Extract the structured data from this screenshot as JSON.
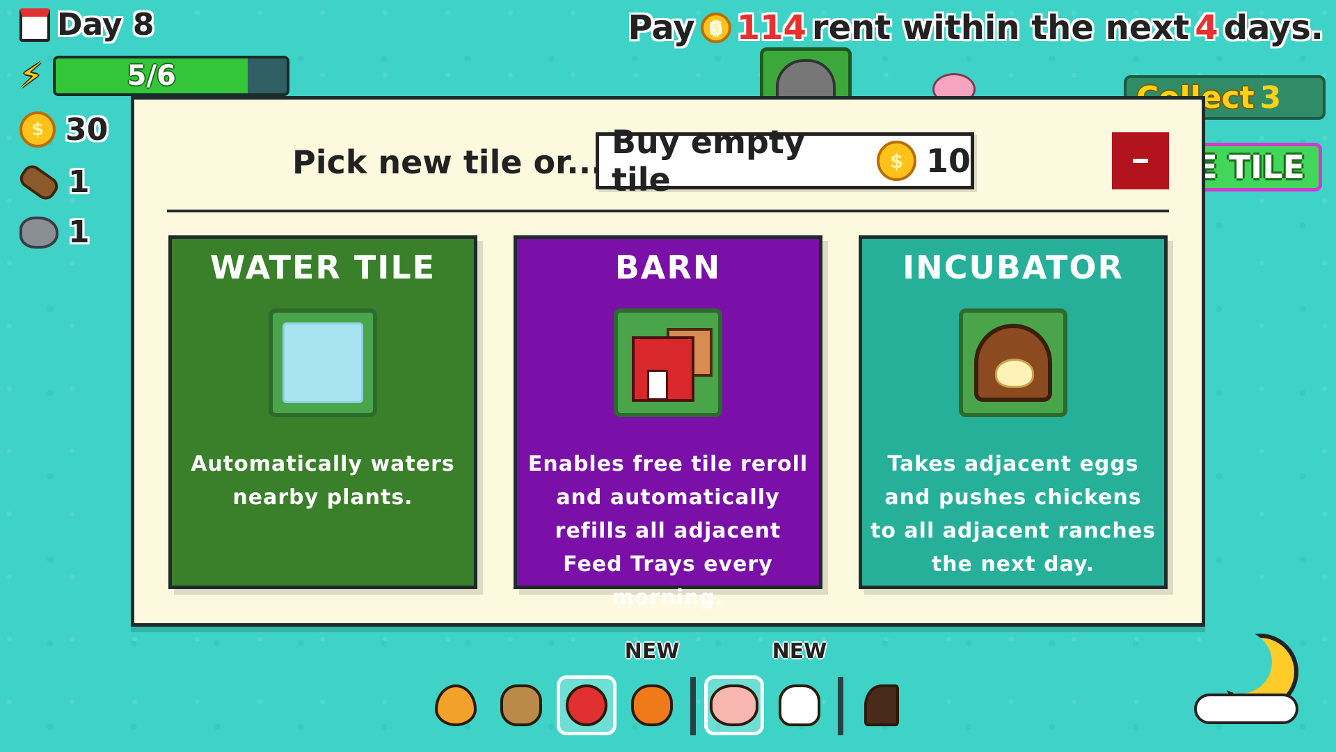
{
  "hud": {
    "day_label": "Day 8",
    "energy": {
      "text": "5/6",
      "current": 5,
      "max": 6
    },
    "coins": "30",
    "wood": "1",
    "stone": "1"
  },
  "rent": {
    "prefix": "Pay",
    "amount": "114",
    "middle": "rent within the next",
    "days": "4",
    "suffix": "days."
  },
  "collect_button": {
    "label": "Collect",
    "count": "3"
  },
  "place_tile_button": {
    "label": "E TILE"
  },
  "dialog": {
    "prompt": "Pick new tile or...",
    "buy_label": "Buy empty tile",
    "buy_cost": "10",
    "minimize_symbol": "–",
    "cards": [
      {
        "title": "WATER TILE",
        "description": "Automatically waters nearby plants.",
        "icon": "water-pond-icon",
        "color": "#3a7f2a"
      },
      {
        "title": "BARN",
        "description": "Enables free tile reroll and automatically refills all adjacent Feed Trays every morning.",
        "icon": "barn-icon",
        "color": "#7a10a8"
      },
      {
        "title": "INCUBATOR",
        "description": "Takes adjacent eggs and pushes chickens to all adjacent ranches the next day.",
        "icon": "incubator-icon",
        "color": "#26b09a"
      }
    ]
  },
  "hotbar": {
    "new_label": "NEW",
    "items": [
      "carrot-icon",
      "potato-icon",
      "tomato-icon",
      "pumpkin-icon",
      "pig-icon",
      "chicken-icon",
      "axe-icon"
    ]
  },
  "colors": {
    "background": "#3fd3c7",
    "dialog_bg": "#fdf9df",
    "minimize_button": "#b3131d",
    "rent_highlight": "#e8302e"
  }
}
